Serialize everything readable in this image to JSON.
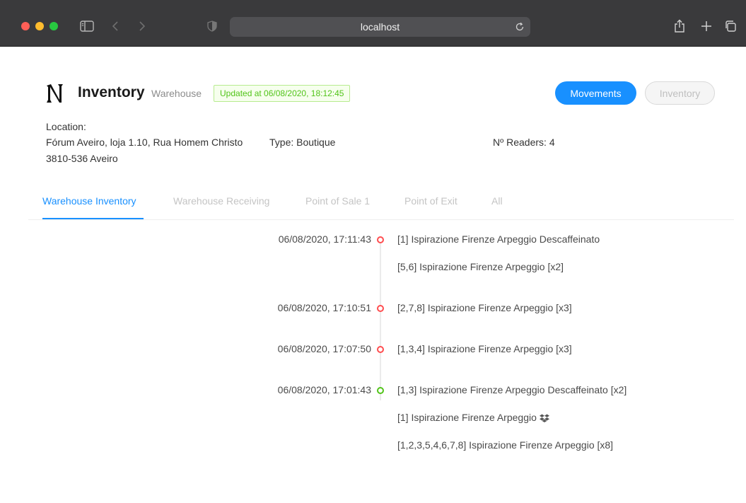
{
  "browser": {
    "url": "localhost"
  },
  "header": {
    "title": "Inventory",
    "subtitle": "Warehouse",
    "updated": "Updated at 06/08/2020, 18:12:45",
    "buttons": {
      "movements": "Movements",
      "inventory": "Inventory"
    }
  },
  "info": {
    "location_label": "Location",
    "location_line1": "Fórum Aveiro, loja 1.10, Rua Homem Christo",
    "location_line2": "3810-536 Aveiro",
    "type_label": "Type",
    "type_value": "Boutique",
    "readers_label": "Nº Readers",
    "readers_value": "4"
  },
  "tabs": [
    {
      "label": "Warehouse Inventory",
      "active": true
    },
    {
      "label": "Warehouse Receiving",
      "active": false
    },
    {
      "label": "Point of Sale 1",
      "active": false
    },
    {
      "label": "Point of Exit",
      "active": false
    },
    {
      "label": "All",
      "active": false
    }
  ],
  "timeline": [
    {
      "time": "06/08/2020, 17:11:43",
      "status": "red",
      "items": [
        "[1] Ispirazione Firenze Arpeggio Descaffeinato",
        "[5,6] Ispirazione Firenze Arpeggio [x2]"
      ]
    },
    {
      "time": "06/08/2020, 17:10:51",
      "status": "red",
      "items": [
        "[2,7,8] Ispirazione Firenze Arpeggio [x3]"
      ]
    },
    {
      "time": "06/08/2020, 17:07:50",
      "status": "red",
      "items": [
        "[1,3,4] Ispirazione Firenze Arpeggio [x3]"
      ]
    },
    {
      "time": "06/08/2020, 17:01:43",
      "status": "green",
      "items": [
        "[1,3] Ispirazione Firenze Arpeggio Descaffeinato [x2]",
        "[1] Ispirazione Firenze Arpeggio",
        "[1,2,3,5,4,6,7,8] Ispirazione Firenze Arpeggio [x8]"
      ]
    }
  ],
  "colors": {
    "accent": "#1890ff",
    "success": "#52c41a",
    "danger": "#ff4d4f"
  },
  "icons": {
    "timeline_extra": "dropbox-icon"
  }
}
